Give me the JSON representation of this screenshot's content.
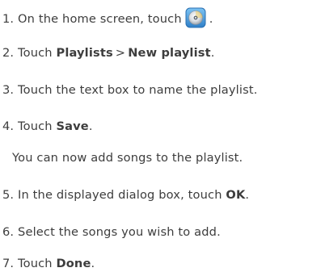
{
  "steps": [
    {
      "number": "1.",
      "pre": "On the home screen, touch",
      "icon": "music-player-cd-icon",
      "post": "."
    },
    {
      "number": "2.",
      "pre": "Touch",
      "bold1": "Playlists",
      "sep": ">",
      "bold2": "New playlist",
      "post": "."
    },
    {
      "number": "3.",
      "text": "Touch the text box to name the playlist."
    },
    {
      "number": "4.",
      "pre": "Touch",
      "bold": "Save",
      "post": "."
    },
    {
      "note": "You can now add songs to the playlist."
    },
    {
      "number": "5.",
      "pre": "In the displayed dialog box, touch",
      "bold": "OK",
      "post": "."
    },
    {
      "number": "6.",
      "text": "Select the songs you wish to add."
    },
    {
      "number": "7.",
      "pre": "Touch",
      "bold": "Done",
      "post": "."
    }
  ],
  "colors": {
    "text": "#3d3d3d",
    "icon_frame": "#3a8fd8",
    "icon_disc": "#d9dde2"
  }
}
